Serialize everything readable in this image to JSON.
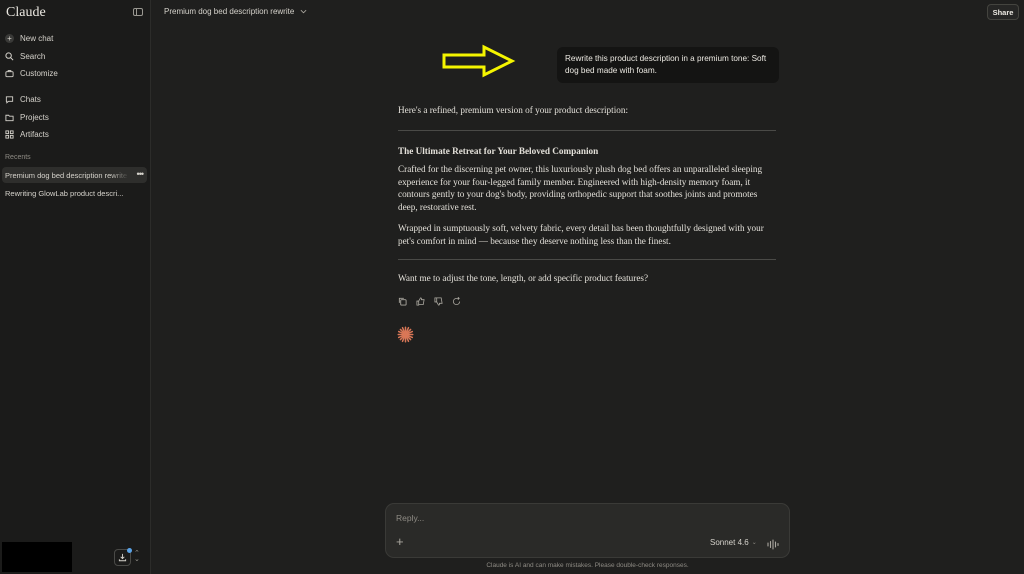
{
  "app": {
    "brand": "Claude"
  },
  "sidebar": {
    "nav": [
      {
        "label": "New chat",
        "icon": "plus-circle-icon"
      },
      {
        "label": "Search",
        "icon": "search-icon"
      },
      {
        "label": "Customize",
        "icon": "briefcase-icon"
      },
      {
        "label": "Chats",
        "icon": "chat-bubble-icon"
      },
      {
        "label": "Projects",
        "icon": "folder-icon"
      },
      {
        "label": "Artifacts",
        "icon": "grid-icon"
      }
    ],
    "recents_label": "Recents",
    "recents": [
      {
        "title": "Premium dog bed description rewrite",
        "active": true
      },
      {
        "title": "Rewriting GlowLab product descri...",
        "active": false
      }
    ]
  },
  "header": {
    "chat_title": "Premium dog bed description rewrite",
    "share_label": "Share"
  },
  "conversation": {
    "user_message": "Rewrite this product description in a premium tone: Soft dog bed made with foam.",
    "assistant": {
      "intro": "Here's a refined, premium version of your product description:",
      "heading": "The Ultimate Retreat for Your Beloved Companion",
      "paragraph1": "Crafted for the discerning pet owner, this luxuriously plush dog bed offers an unparalleled sleeping experience for your four-legged family member. Engineered with high-density memory foam, it contours gently to your dog's body, providing orthopedic support that soothes joints and promotes deep, restorative rest.",
      "paragraph2": "Wrapped in sumptuously soft, velvety fabric, every detail has been thoughtfully designed with your pet's comfort in mind — because they deserve nothing less than the finest.",
      "question": "Want me to adjust the tone, length, or add specific product features?"
    },
    "actions": [
      "copy-icon",
      "thumbs-up-icon",
      "thumbs-down-icon",
      "retry-icon"
    ]
  },
  "composer": {
    "placeholder": "Reply...",
    "model": "Sonnet 4.6",
    "disclaimer": "Claude is AI and can make mistakes. Please double-check responses."
  },
  "colors": {
    "background": "#1f1f1e",
    "sidebar": "#1b1b1a",
    "annotation_arrow": "#f5f500",
    "spark": "#d97757"
  }
}
